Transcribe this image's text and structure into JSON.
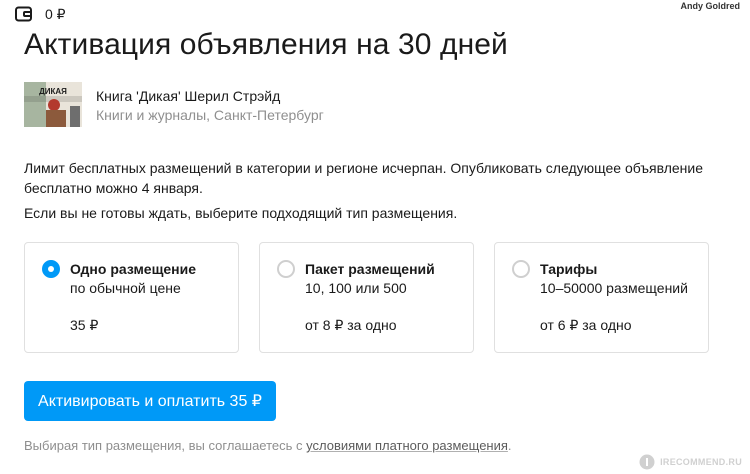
{
  "header": {
    "balance": "0 ₽",
    "username": "Andy Goldred"
  },
  "page": {
    "title": "Активация объявления на 30 дней"
  },
  "listing": {
    "thumbnail_text": "ДИКАЯ",
    "title": "Книга 'Дикая' Шерил Стрэйд",
    "subtitle": "Книги и журналы, Санкт-Петербург"
  },
  "notice": "Лимит бесплатных размещений в категории и регионе исчерпан. Опубликовать следующее объявление бесплатно можно 4 января.",
  "prompt": "Если вы не готовы ждать, выберите подходящий тип размещения.",
  "options": [
    {
      "title": "Одно размещение",
      "subtitle": "по обычной цене",
      "price": "35 ₽",
      "selected": true
    },
    {
      "title": "Пакет размещений",
      "subtitle": "10, 100 или 500",
      "price": "от 8 ₽ за одно",
      "selected": false
    },
    {
      "title": "Тарифы",
      "subtitle": "10–50000 размещений",
      "price": "от 6 ₽ за одно",
      "selected": false
    }
  ],
  "pay_button": "Активировать и оплатить 35 ₽",
  "agreement": {
    "text": "Выбирая тип размещения, вы соглашаетесь с ",
    "link": "условиями платного размещения",
    "end": "."
  },
  "watermark": "IRECOMMEND.RU",
  "colors": {
    "accent": "#0099f7",
    "muted_text": "#8f8f8f",
    "card_border": "#e0e0e0"
  }
}
